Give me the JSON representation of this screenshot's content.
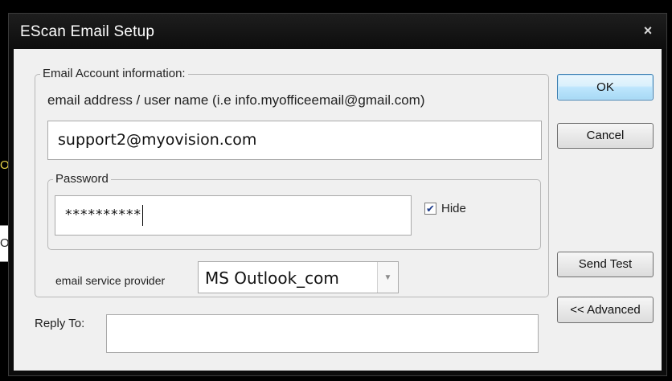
{
  "window": {
    "title": "EScan Email Setup",
    "close_glyph": "×"
  },
  "background_fragments": {
    "top": "O",
    "middle": "O"
  },
  "account_group": {
    "legend": "Email Account information:",
    "email_label": "email address / user name (i.e info.myofficeemail@gmail.com)",
    "email_value": "support2@myovision.com"
  },
  "password_group": {
    "legend": "Password",
    "value_masked": "**********",
    "hide_label": "Hide",
    "hide_checked": true,
    "check_glyph": "✔"
  },
  "provider": {
    "label": "email service provider",
    "selected": "MS Outlook_com",
    "arrow_glyph": "▼"
  },
  "reply_to": {
    "label": "Reply To:",
    "value": ""
  },
  "buttons": {
    "ok": "OK",
    "cancel": "Cancel",
    "send_test": "Send Test",
    "advanced": "<< Advanced"
  },
  "icons": {
    "close": "close-icon",
    "checkbox": "checkmark-icon",
    "dropdown": "chevron-down-icon"
  }
}
